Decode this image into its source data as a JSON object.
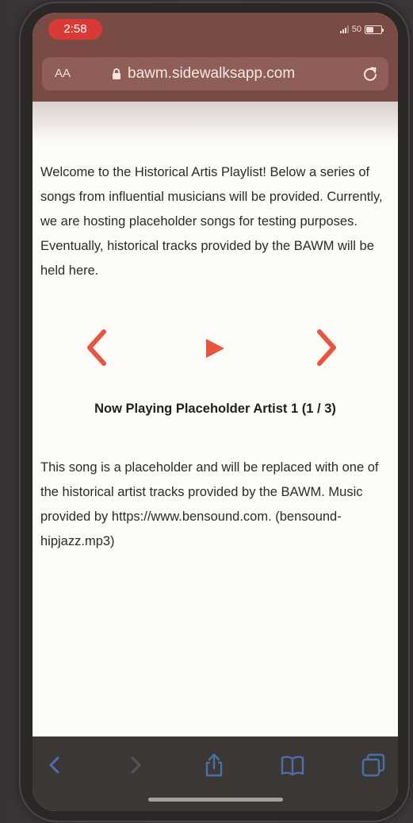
{
  "status_bar": {
    "time": "2:58",
    "battery_label": "50",
    "battery_level": 0.5
  },
  "browser": {
    "text_size_label": "AA",
    "url": "bawm.sidewalksapp.com"
  },
  "page": {
    "intro_text": "Welcome to the Historical Artis Playlist! Below a series of songs from influential musicians will be provided. Currently, we are hosting placeholder songs for testing purposes. Eventually, historical tracks provided by the BAWM will be held here.",
    "now_playing": "Now Playing Placeholder Artist 1 (1 / 3)",
    "description": "This song is a placeholder and will be replaced with one of the historical artist tracks provided by the BAWM. Music provided by https://www.bensound.com. (bensound-hipjazz.mp3)"
  },
  "player": {
    "prev_icon": "chevron-left-icon",
    "play_icon": "play-icon",
    "next_icon": "chevron-right-icon",
    "accent_color": "#e8553f"
  },
  "toolbar": {
    "icons": [
      "back-icon",
      "forward-icon",
      "share-icon",
      "bookmarks-icon",
      "tabs-icon"
    ],
    "icon_color": "#4c6ea9"
  }
}
